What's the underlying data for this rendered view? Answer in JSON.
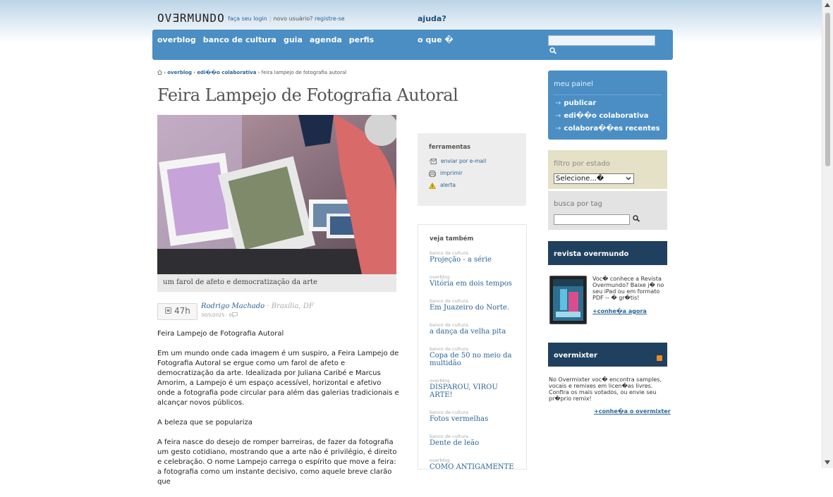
{
  "header": {
    "logo": "OVƎRMUNDO",
    "login_link": "faça seu login",
    "new_user_text": "novo usuário?",
    "register_link": "registre-se",
    "help_link": "ajuda?"
  },
  "nav": {
    "items": [
      {
        "label": "overblog"
      },
      {
        "label": "banco de cultura"
      },
      {
        "label": "guia"
      },
      {
        "label": "agenda"
      },
      {
        "label": "perfis"
      }
    ],
    "oque": "o que �",
    "search_placeholder": ""
  },
  "breadcrumb": {
    "sep": " › ",
    "items": [
      "overblog",
      "edi��o colaborativa"
    ],
    "current": "feira lampejo de fotografia autoral"
  },
  "article": {
    "title": "Feira Lampejo de Fotografia Autoral",
    "caption": "um farol de afeto e democratização da arte",
    "time_ago": "47h",
    "author": "Rodrigo Machado",
    "location": "· Brasília, DF",
    "date": "30/5/2025 · 0",
    "paragraphs": [
      "Feira Lampejo de Fotografia Autoral",
      "Em um mundo onde cada imagem é um suspiro, a Feira Lampejo de Fotografia Autoral se ergue como um farol de afeto e democratização da arte. Idealizada por Juliana Caribé e Marcus Amorim, a Lampejo é um espaço acessível, horizontal e afetivo onde a fotografia pode circular para além das galerias tradicionais e alcançar novos públicos.",
      "A beleza que se populariza",
      "A feira nasce do desejo de romper barreiras, de fazer da fotografia um gesto cotidiano, mostrando que a arte não é privilégio, é direito e celebração. O nome Lampejo carrega o espírito que move a feira: a fotografia como um instante decisivo, como aquele breve clarão que"
    ]
  },
  "tools": {
    "title": "ferramentas",
    "email": "enviar por e-mail",
    "print": "imprimir",
    "alert": "alerta"
  },
  "see_also": {
    "title": "veja também",
    "items": [
      {
        "cat": "banco de cultura",
        "title": "Projeção - a série"
      },
      {
        "cat": "overblog",
        "title": "Vitória em dois tempos"
      },
      {
        "cat": "banco de cultura",
        "title": "Em Juazeiro do Norte."
      },
      {
        "cat": "banco de cultura",
        "title": "a dança da velha pita"
      },
      {
        "cat": "banco de cultura",
        "title": "Copa de 50 no meio da multidão"
      },
      {
        "cat": "overblog",
        "title": "DISPAROU, VIROU ARTE!"
      },
      {
        "cat": "banco de cultura",
        "title": "Fotos vermelhas"
      },
      {
        "cat": "banco de cultura",
        "title": "Dente de leão"
      },
      {
        "cat": "overblog",
        "title": "COMO ANTIGAMENTE"
      }
    ]
  },
  "panel": {
    "title": "meu painel",
    "items": [
      "publicar",
      "edi��o colaborativa",
      "colabora��es recentes"
    ]
  },
  "filter": {
    "title": "filtro por estado",
    "selected": "Selecione...�"
  },
  "tag_search": {
    "title": "busca por tag"
  },
  "revista": {
    "title": "revista overmundo",
    "text": "Voc� conhece a Revista Overmundo? Baixe j� no seu iPad ou em formato PDF -- � gr�tis!",
    "link": "+conhe�a agora"
  },
  "overmixter": {
    "title": "overmixter",
    "text": "No Overmixter voc� encontra samples, vocais e remixes em licen�as livres. Confira os mais votados, ou envie seu pr�prio remix!",
    "link": "+conhe�a o overmixter"
  },
  "colors": {
    "nav_blue": "#4b8ec4",
    "dark_navy": "#1f405f",
    "link_blue": "#2a6496",
    "filter_bg": "#e5e1c7"
  }
}
